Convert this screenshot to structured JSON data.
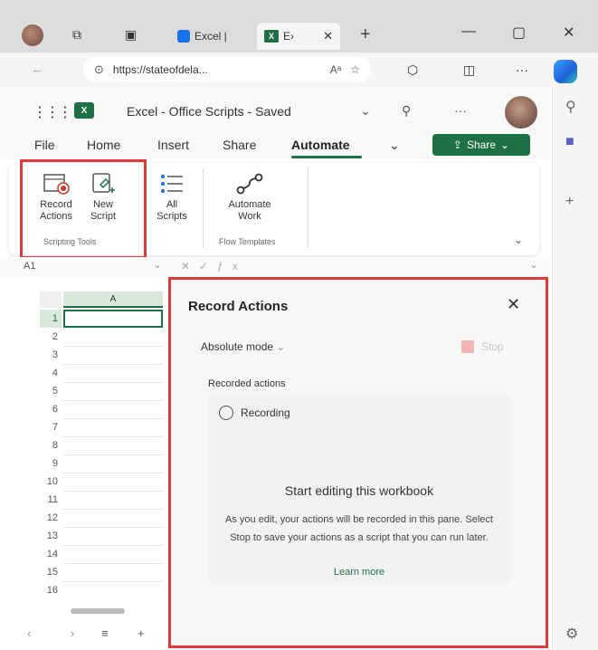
{
  "browser": {
    "tabs": [
      {
        "label": "Excel |",
        "active": false
      },
      {
        "label": "E›",
        "active": true
      }
    ],
    "url": "https://stateofdela...",
    "addr_icons": {
      "reader": "Aᵃ",
      "favorite": "☆",
      "extensions": "⬡",
      "split": "◫",
      "more": "···"
    }
  },
  "excel": {
    "doc_title": "Excel - Office Scripts - Saved",
    "ribbon_tabs": [
      "File",
      "Home",
      "Insert",
      "Share",
      "Automate"
    ],
    "active_tab": "Automate",
    "share_label": "Share",
    "ribbon": {
      "record_actions": "Record Actions",
      "new_script": "New Script",
      "scripting_group": "Scripting Tools",
      "all_scripts": "All Scripts",
      "automate_work": "Automate Work",
      "flow_group": "Flow Templates"
    },
    "namebox": "A1",
    "column_header": "A",
    "rows": [
      "1",
      "2",
      "3",
      "4",
      "5",
      "6",
      "7",
      "8",
      "9",
      "10",
      "11",
      "12",
      "13",
      "14",
      "15",
      "16"
    ]
  },
  "pane": {
    "title": "Record Actions",
    "mode": "Absolute mode",
    "stop_label": "Stop",
    "recorded_label": "Recorded actions",
    "status": "Recording",
    "empty_title": "Start editing this workbook",
    "empty_body": "As you edit, your actions will be recorded in this pane. Select Stop to save your actions as a script that you can run later.",
    "learn_more": "Learn more"
  },
  "colors": {
    "accent": "#1e7145",
    "highlight": "#e03a3a"
  }
}
